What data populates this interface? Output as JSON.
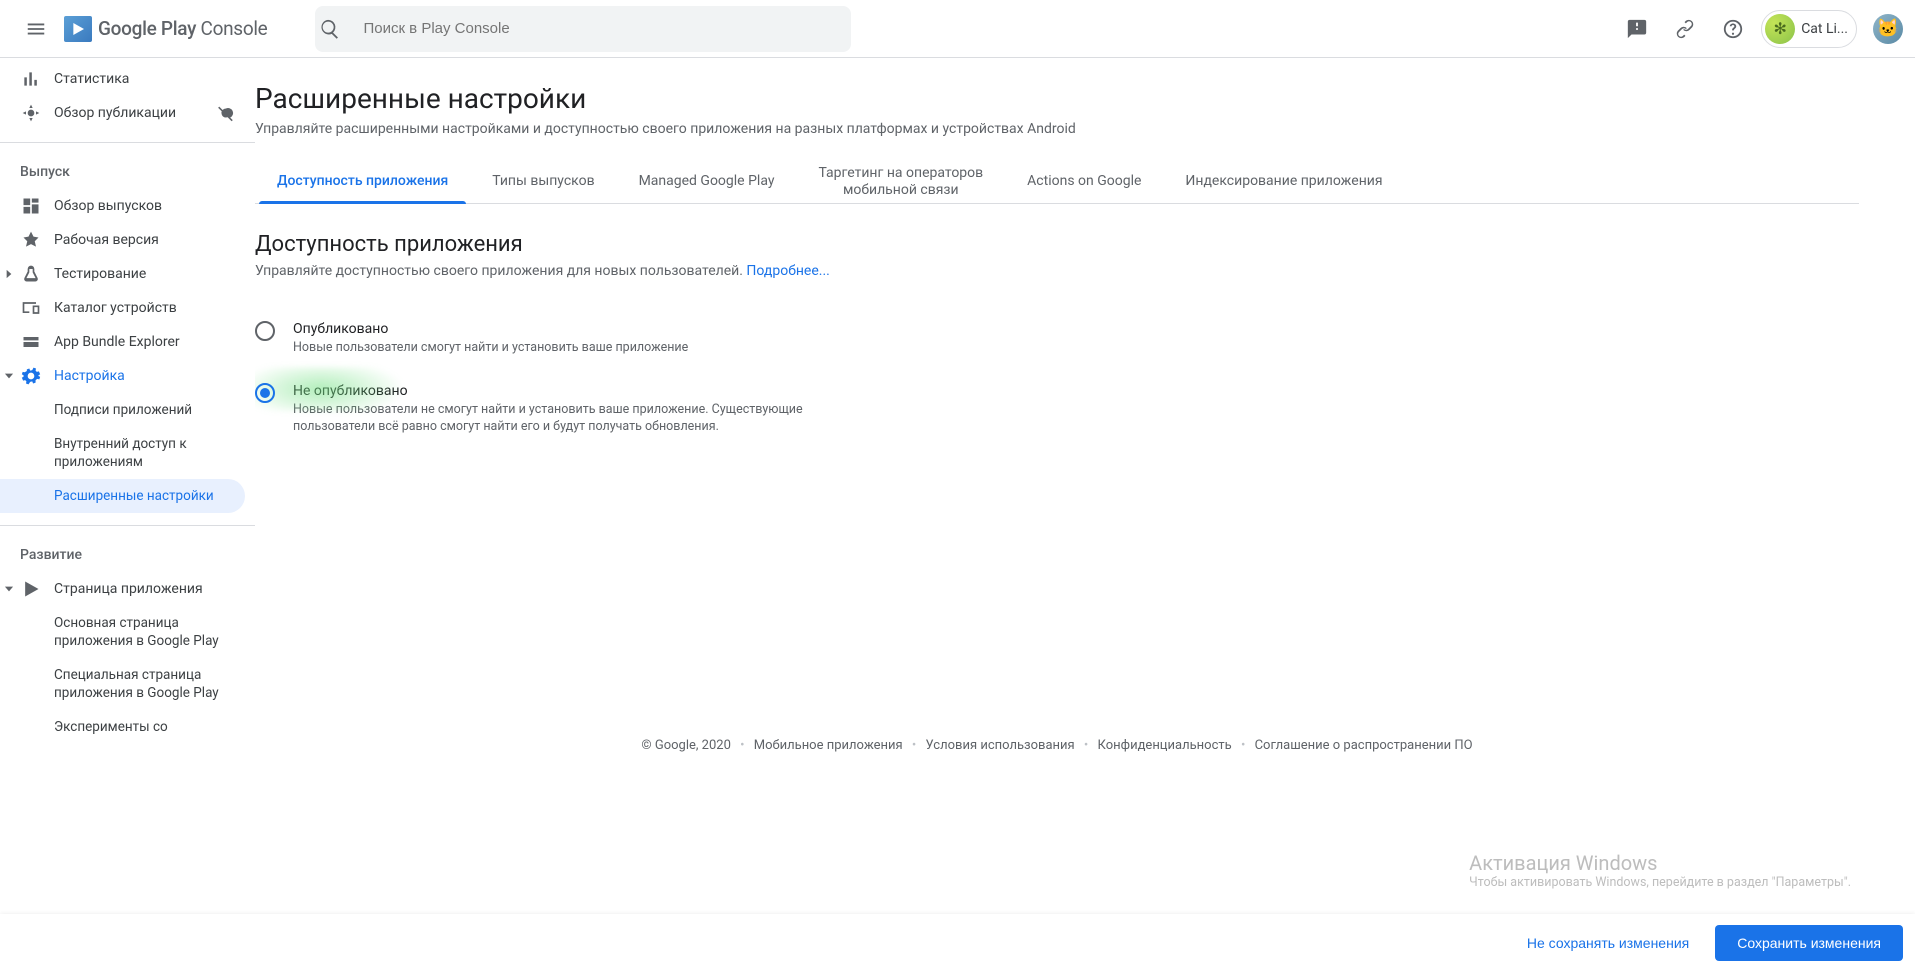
{
  "header": {
    "logo_text_a": "Google Play",
    "logo_text_b": "Console",
    "search_placeholder": "Поиск в Play Console",
    "account_name": "Cat Li..."
  },
  "sidebar": {
    "top_items": [
      {
        "label": "Статистика"
      },
      {
        "label": "Обзор публикации"
      }
    ],
    "section_release": "Выпуск",
    "release_items": [
      {
        "label": "Обзор выпусков"
      },
      {
        "label": "Рабочая версия"
      },
      {
        "label": "Тестирование"
      },
      {
        "label": "Каталог устройств"
      },
      {
        "label": "App Bundle Explorer"
      },
      {
        "label": "Настройка"
      }
    ],
    "setup_sub": [
      {
        "label": "Подписи приложений"
      },
      {
        "label": "Внутренний доступ к приложениям"
      },
      {
        "label": "Расширенные настройки"
      }
    ],
    "section_growth": "Развитие",
    "growth_items": [
      {
        "label": "Страница приложения"
      }
    ],
    "growth_sub": [
      {
        "label": "Основная страница приложения в Google Play"
      },
      {
        "label": "Специальная страница приложения в Google Play"
      },
      {
        "label": "Эксперименты со"
      }
    ]
  },
  "main": {
    "title": "Расширенные настройки",
    "subtitle": "Управляйте расширенными настройками и доступностью своего приложения на разных платформах и устройствах Android",
    "tabs": [
      "Доступность приложения",
      "Типы выпусков",
      "Managed Google Play",
      "Таргетинг на операторов\nмобильной связи",
      "Actions on Google",
      "Индексирование приложения"
    ],
    "section_title": "Доступность приложения",
    "section_desc": "Управляйте доступностью своего приложения для новых пользователей.",
    "section_link": "Подробнее...",
    "radio": [
      {
        "label": "Опубликовано",
        "desc": "Новые пользователи смогут найти и установить ваше приложение"
      },
      {
        "label": "Не опубликовано",
        "desc": "Новые пользователи не смогут найти и установить ваше приложение. Существующие пользователи всё равно смогут найти его и будут получать обновления."
      }
    ]
  },
  "footer": {
    "items": [
      "© Google, 2020",
      "Мобильное приложения",
      "Условия использования",
      "Конфиденциальность",
      "Соглашение о распространении ПО"
    ]
  },
  "watermark": {
    "line1": "Активация Windows",
    "line2": "Чтобы активировать Windows, перейдите в раздел \"Параметры\"."
  },
  "bottombar": {
    "discard": "Не сохранять изменения",
    "save": "Сохранить изменения"
  }
}
